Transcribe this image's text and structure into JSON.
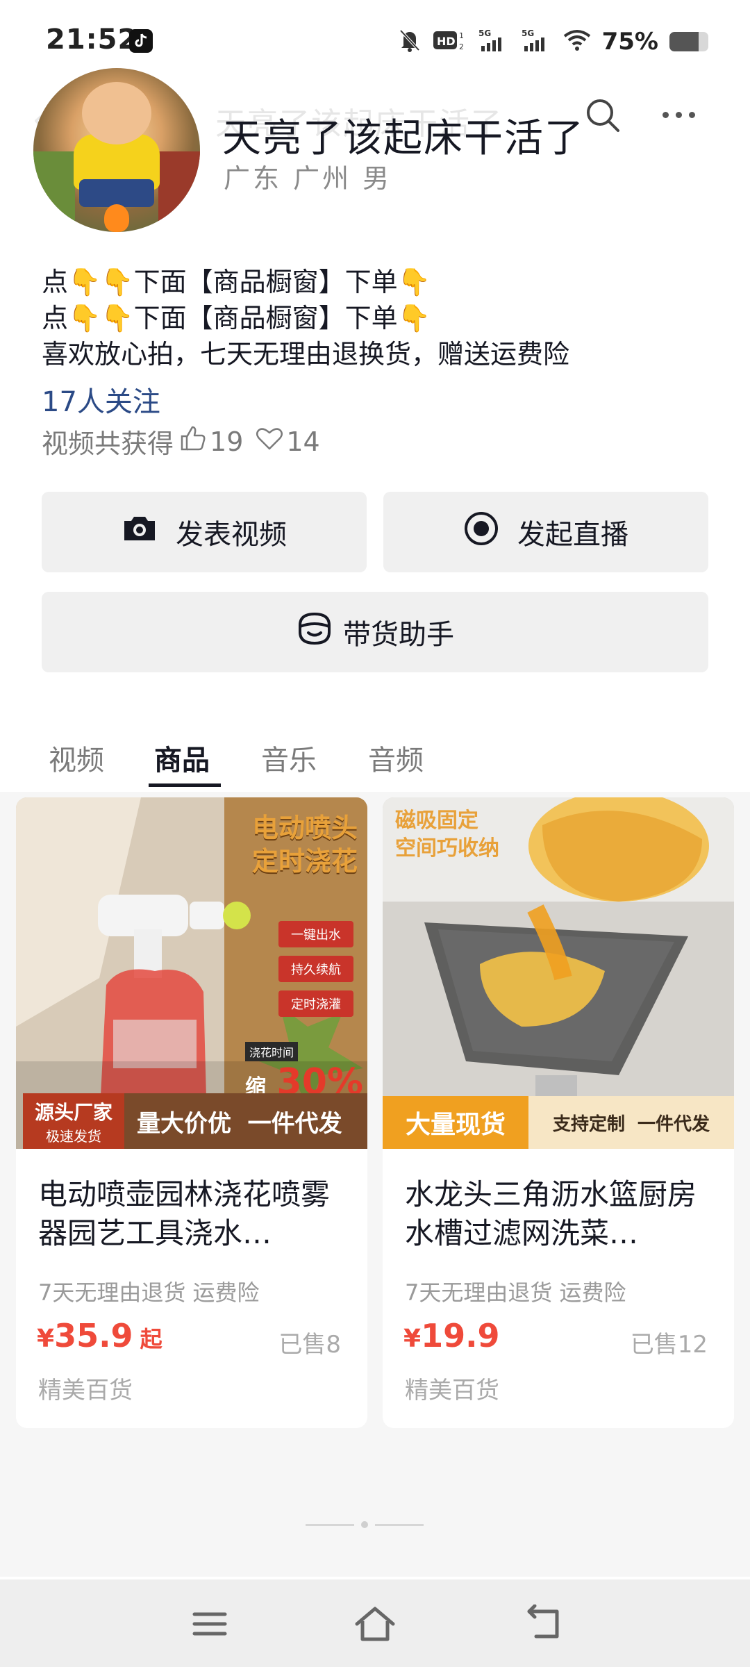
{
  "status_bar": {
    "time": "21:52",
    "battery_pct": "75%",
    "battery_level": 0.75,
    "icons": [
      "tiktok-icon",
      "mute-bell-icon",
      "hd-icon",
      "signal-5g-icon",
      "signal-5g-icon",
      "wifi-icon",
      "battery-icon"
    ]
  },
  "header": {
    "faded_name": "天亮了该起床干活了",
    "name": "天亮了该起床干活了",
    "meta": "广东 广州 男"
  },
  "bio": {
    "line1": "点👇👇下面【商品橱窗】下单👇",
    "line2": "点👇👇下面【商品橱窗】下单👇",
    "line3": "喜欢放心拍，七天无理由退换货，赠送运费险"
  },
  "followers": "17人关注",
  "likes": {
    "prefix": "视频共获得",
    "thumbs": "19",
    "hearts": "14"
  },
  "actions": {
    "post": "发表视频",
    "live": "发起直播",
    "helper": "带货助手"
  },
  "tabs": [
    {
      "label": "视频"
    },
    {
      "label": "商品"
    },
    {
      "label": "音乐"
    },
    {
      "label": "音频"
    }
  ],
  "products": [
    {
      "img_title_1": "电动喷头",
      "img_title_2": "定时浇花",
      "img_tags": [
        "一键出水",
        "持久续航",
        "定时浇灌"
      ],
      "img_badge_label": "浇花时间",
      "img_badge_main": "缩短",
      "img_badge_pct": "30%",
      "img_corner_1": "源头厂家",
      "img_corner_2": "极速发货",
      "img_bottom": "量大价优  一件代发",
      "title": "电动喷壶园林浇花喷雾器园艺工具浇水…",
      "tags": "7天无理由退货  运费险",
      "currency": "¥",
      "price": "35.9",
      "price_suffix": "起",
      "sold": "已售8",
      "shop": "精美百货"
    },
    {
      "img_title_1": "磁吸固定",
      "img_title_2": "空间巧收纳",
      "img_corner": "大量现货",
      "img_bottom": "支持定制  一件代发",
      "title": "水龙头三角沥水篮厨房水槽过滤网洗菜…",
      "tags": "7天无理由退货  运费险",
      "currency": "¥",
      "price": "19.9",
      "price_suffix": "",
      "sold": "已售12",
      "shop": "精美百货"
    }
  ],
  "navbar": {
    "icons": [
      "menu-icon",
      "home-icon",
      "back-icon"
    ]
  }
}
